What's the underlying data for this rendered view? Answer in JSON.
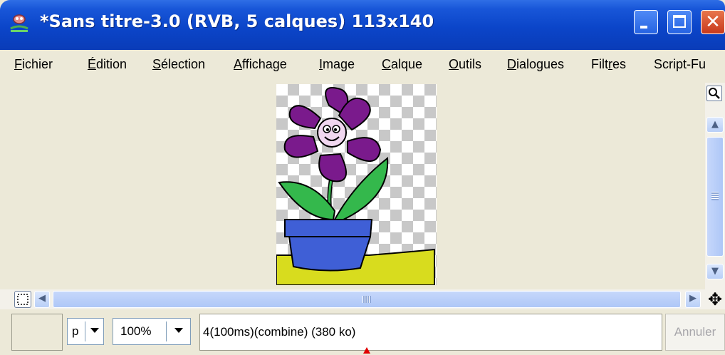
{
  "window": {
    "title": "*Sans titre-3.0 (RVB, 5 calques) 113x140",
    "icon": "gimp-wilber-icon",
    "buttons": [
      "minimize-icon",
      "maximize-icon",
      "close-icon"
    ]
  },
  "menu": {
    "items": [
      {
        "pre": "",
        "u": "F",
        "post": "ichier"
      },
      {
        "pre": "",
        "u": "É",
        "post": "dition"
      },
      {
        "pre": "",
        "u": "S",
        "post": "élection"
      },
      {
        "pre": "",
        "u": "A",
        "post": "ffichage"
      },
      {
        "pre": "",
        "u": "I",
        "post": "mage"
      },
      {
        "pre": "",
        "u": "C",
        "post": "alque"
      },
      {
        "pre": "",
        "u": "O",
        "post": "utils"
      },
      {
        "pre": "",
        "u": "D",
        "post": "ialogues"
      },
      {
        "pre": "Filt",
        "u": "r",
        "post": "es"
      },
      {
        "pre": "",
        "u": "",
        "post": "Script-Fu"
      }
    ]
  },
  "canvas": {
    "image_description_icon": "flower-pot-image",
    "checkerboard": true
  },
  "statusbar": {
    "unit_value": "p",
    "zoom_value": "100%",
    "status_text": "4(100ms)(combine) (380 ko)",
    "cancel_label": "Annuler"
  },
  "colors": {
    "titlebar": "#0b45c9",
    "menubar_bg": "#ece9d8",
    "scrollbar_thumb": "#b9cff7",
    "petal": "#7a1a8c",
    "leaf": "#34b84c",
    "pot": "#3f5fd6",
    "ground": "#d8dc1e",
    "progress_marker": "#e00000"
  }
}
